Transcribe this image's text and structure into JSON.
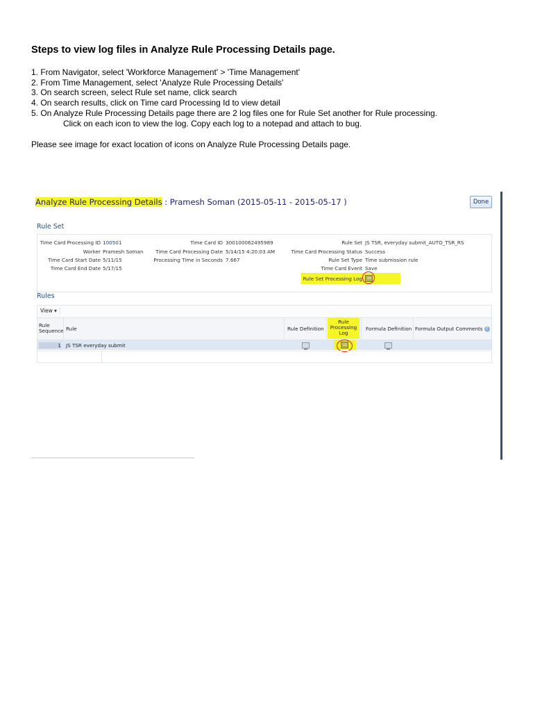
{
  "document": {
    "title": "Steps to view log files in Analyze Rule Processing Details page.",
    "steps": [
      "1. From Navigator, select 'Workforce Management' > 'Time Management'",
      "2. From Time Management, select 'Analyze Rule Processing Details'",
      "3. On search screen, select Rule set name, click search",
      "4. On search results, click on Time card Processing Id to view detail",
      "5. On Analyze Rule Processing Details page there are 2 log files one for Rule Set another for Rule processing."
    ],
    "step5_continuation": "Click on each icon to view the log. Copy each log to a notepad and attach to bug.",
    "note": "Please see image for exact location of icons on Analyze Rule Processing Details page."
  },
  "screenshot": {
    "page_title_highlight": "Analyze Rule Processing Details",
    "page_title_rest": " : Pramesh Soman (2015-05-11 - 2015-05-17 )",
    "done_label": "Done",
    "rule_set_heading": "Rule Set",
    "rules_heading": "Rules",
    "highlight_color": "#f5f527",
    "circle_color": "#d12020",
    "col1": [
      {
        "label": "Time Card Processing ID",
        "value": "100501"
      },
      {
        "label": "Worker",
        "value": "Pramesh Soman"
      },
      {
        "label": "Time Card Start Date",
        "value": "5/11/15"
      },
      {
        "label": "Time Card End Date",
        "value": "5/17/15"
      }
    ],
    "col2": [
      {
        "label": "Time Card ID",
        "value": "300100062495989"
      },
      {
        "label": "Time Card Processing Date",
        "value": "5/14/15 4:20:03 AM"
      },
      {
        "label": "Processing Time in Seconds",
        "value": "7.667"
      }
    ],
    "col3": [
      {
        "label": "Rule Set",
        "value": "JS TSR, everyday submit_AUTO_TSR_RS"
      },
      {
        "label": "Time Card Processing Status",
        "value": "Success"
      },
      {
        "label": "Rule Set Type",
        "value": "Time submission rule"
      },
      {
        "label": "Time Card Event",
        "value": "Save"
      },
      {
        "label": "Rule Set Processing Log",
        "value": ""
      }
    ],
    "rules_table": {
      "view_label": "View ▾",
      "headers": {
        "sequence": [
          "Rule",
          "Sequence"
        ],
        "rule": "Rule",
        "definition": "Rule Definition",
        "processing_log": [
          "Rule",
          "Processing",
          "Log"
        ],
        "formula_definition": "Formula Definition",
        "formula_output": "Formula Output Comments"
      },
      "rows": [
        {
          "sequence": "1",
          "rule": "JS TSR everyday submit"
        }
      ]
    },
    "icons": {
      "log_icon": "document-log-icon",
      "definition_icon": "definition-icon",
      "help_icon": "help-icon"
    }
  }
}
